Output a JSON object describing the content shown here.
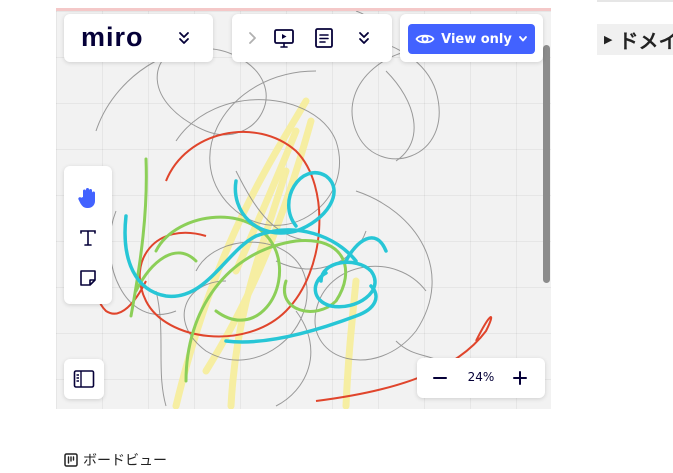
{
  "app": {
    "logo_text": "miro"
  },
  "header": {
    "view_mode_label": "View only"
  },
  "zoom": {
    "level": "24%"
  },
  "sidebar": {
    "expand_label": "ドメイ"
  },
  "footer": {
    "board_view_label": "ボードビュー"
  },
  "icons": {
    "chevrons_down": "chevrons-down-icon",
    "chevron_right": "chevron-right-icon",
    "presentation": "presentation-icon",
    "notes": "notes-icon",
    "eye": "eye-icon",
    "chevron_down": "chevron-down-icon",
    "hand": "hand-icon",
    "text": "text-icon",
    "sticky_note": "sticky-note-icon",
    "sidebar_panel": "sidebar-panel-icon",
    "minus": "minus-icon",
    "plus": "plus-icon",
    "board": "board-icon",
    "triangle_right": "triangle-right-icon"
  },
  "colors": {
    "brand_blue": "#4262ff",
    "ink_dark": "#050038",
    "stroke_gray": "#8a8a8a",
    "stroke_red": "#e0452c",
    "stroke_green": "#8ccf58",
    "stroke_cyan": "#27c6d6",
    "stroke_yellow": "#f7ee9a"
  }
}
